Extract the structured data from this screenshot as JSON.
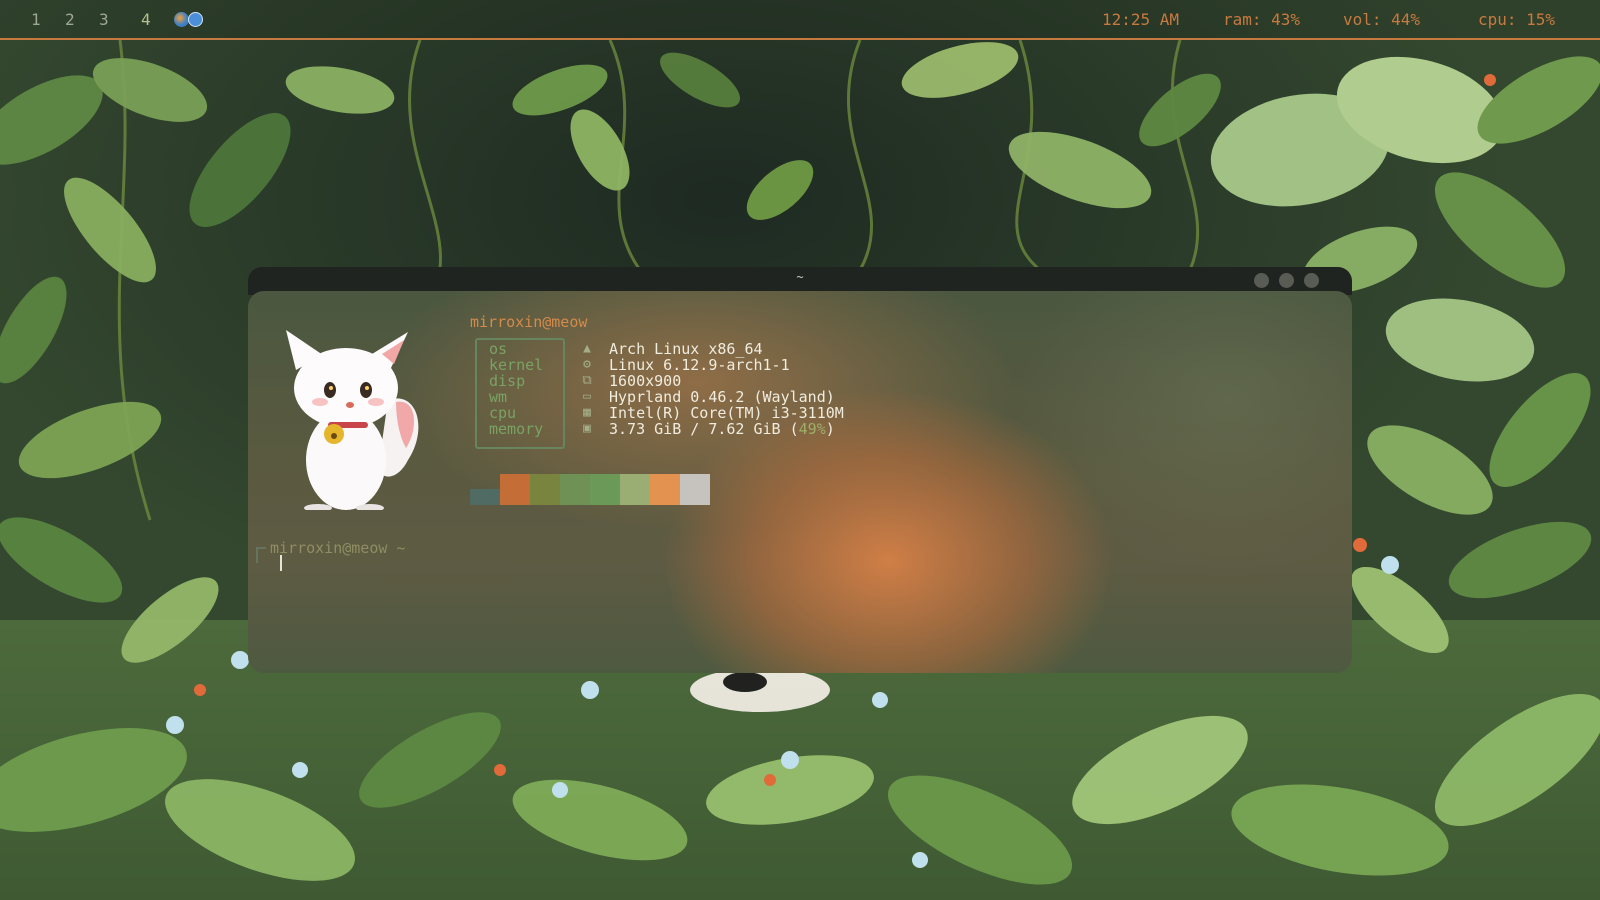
{
  "topbar": {
    "workspaces": [
      "1",
      "2",
      "3",
      "4"
    ],
    "active_workspace": "4",
    "tray_icons": [
      "network-globe-icon",
      "messaging-app-icon"
    ],
    "clock": "12:25 AM",
    "ram": "ram: 43%",
    "vol": "vol: 44%",
    "cpu": "cpu: 15%",
    "accent_color": "#c77a3f"
  },
  "window": {
    "title": "~",
    "buttons": [
      "minimize-icon",
      "maximize-icon",
      "close-icon"
    ]
  },
  "fetch": {
    "user_host": "mirroxin@meow",
    "avatar": "white-cat-character-with-bell-collar",
    "rows": [
      {
        "key": "os",
        "icon": "arch-logo-icon",
        "value": "Arch Linux x86_64"
      },
      {
        "key": "kernel",
        "icon": "gear-icon",
        "value": "Linux 6.12.9-arch1-1"
      },
      {
        "key": "disp",
        "icon": "display-icon",
        "value": "1600x900"
      },
      {
        "key": "wm",
        "icon": "window-icon",
        "value": "Hyprland 0.46.2 (Wayland)"
      },
      {
        "key": "cpu",
        "icon": "chip-icon",
        "value": "Intel(R) Core(TM) i3-3110M"
      },
      {
        "key": "memory",
        "icon": "memory-icon",
        "value": "3.73 GiB / 7.62 GiB (",
        "percent": "49%",
        "suffix": ")"
      }
    ],
    "palette": [
      "#4f6b64",
      "#c56d37",
      "#79853f",
      "#6f9156",
      "#6b9a58",
      "#9aad73",
      "#e3924f",
      "#c6c3be"
    ]
  },
  "prompt": {
    "text": "mirroxin@meow ~"
  }
}
